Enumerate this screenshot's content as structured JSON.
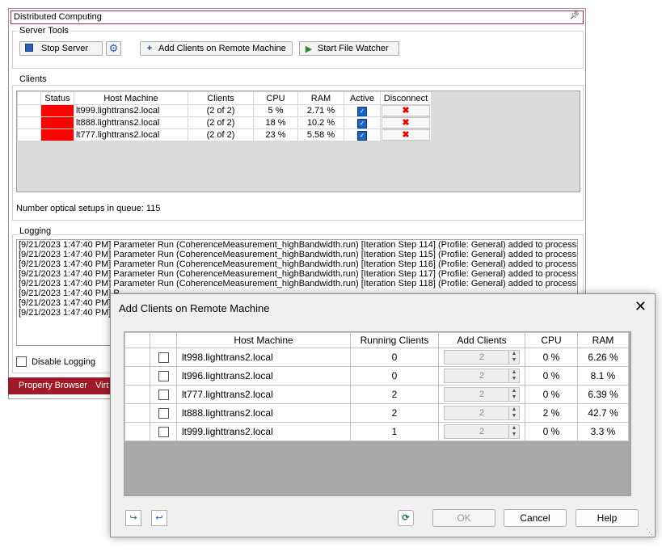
{
  "panel": {
    "title": "Distributed Computing",
    "server_tools": {
      "label": "Server Tools",
      "stop_label": "Stop Server",
      "add_clients_label": "Add Clients on Remote Machine",
      "watcher_label": "Start File Watcher"
    },
    "clients": {
      "label": "Clients",
      "columns": [
        "Status",
        "Host Machine",
        "Clients",
        "CPU",
        "RAM",
        "Active",
        "Disconnect"
      ],
      "rows": [
        {
          "status_color": "#ff0000",
          "host": "lt999.lighttrans2.local",
          "clients": "(2 of 2)",
          "cpu": "5 %",
          "ram": "2.71 %",
          "active": true
        },
        {
          "status_color": "#ff0000",
          "host": "lt888.lighttrans2.local",
          "clients": "(2 of 2)",
          "cpu": "18 %",
          "ram": "10.2 %",
          "active": true
        },
        {
          "status_color": "#ff0000",
          "host": "lt777.lighttrans2.local",
          "clients": "(2 of 2)",
          "cpu": "23 %",
          "ram": "5.58 %",
          "active": true
        }
      ]
    },
    "queue_text": "Number optical setups in queue: 115",
    "logging": {
      "label": "Logging",
      "lines": [
        "[9/21/2023 1:47:40 PM] Parameter Run (CoherenceMeasurement_highBandwidth.run) [Iteration Step 114] (Profile: General) added to processing",
        "[9/21/2023 1:47:40 PM] Parameter Run (CoherenceMeasurement_highBandwidth.run) [Iteration Step 115] (Profile: General) added to processing",
        "[9/21/2023 1:47:40 PM] Parameter Run (CoherenceMeasurement_highBandwidth.run) [Iteration Step 116] (Profile: General) added to processing",
        "[9/21/2023 1:47:40 PM] Parameter Run (CoherenceMeasurement_highBandwidth.run) [Iteration Step 117] (Profile: General) added to processing",
        "[9/21/2023 1:47:40 PM] Parameter Run (CoherenceMeasurement_highBandwidth.run) [Iteration Step 118] (Profile: General) added to processing",
        "[9/21/2023 1:47:40 PM] P",
        "[9/21/2023 1:47:40 PM] P",
        "[9/21/2023 1:47:40 PM] P"
      ],
      "disable_label": "Disable Logging"
    },
    "bottom_tabs": [
      "Property Browser",
      "Virt"
    ]
  },
  "dialog": {
    "title": "Add Clients on Remote Machine",
    "columns": [
      "Host Machine",
      "Running Clients",
      "Add Clients",
      "CPU",
      "RAM"
    ],
    "rows": [
      {
        "host": "lt998.lighttrans2.local",
        "running": "0",
        "add": "2",
        "cpu": "0 %",
        "ram": "6.26 %"
      },
      {
        "host": "lt996.lighttrans2.local",
        "running": "0",
        "add": "2",
        "cpu": "0 %",
        "ram": "8.1 %"
      },
      {
        "host": "lt777.lighttrans2.local",
        "running": "2",
        "add": "2",
        "cpu": "0 %",
        "ram": "6.39 %"
      },
      {
        "host": "lt888.lighttrans2.local",
        "running": "2",
        "add": "2",
        "cpu": "2 %",
        "ram": "42.7 %"
      },
      {
        "host": "lt999.lighttrans2.local",
        "running": "1",
        "add": "2",
        "cpu": "0 %",
        "ram": "3.3 %"
      }
    ],
    "ok_label": "OK",
    "cancel_label": "Cancel",
    "help_label": "Help"
  }
}
